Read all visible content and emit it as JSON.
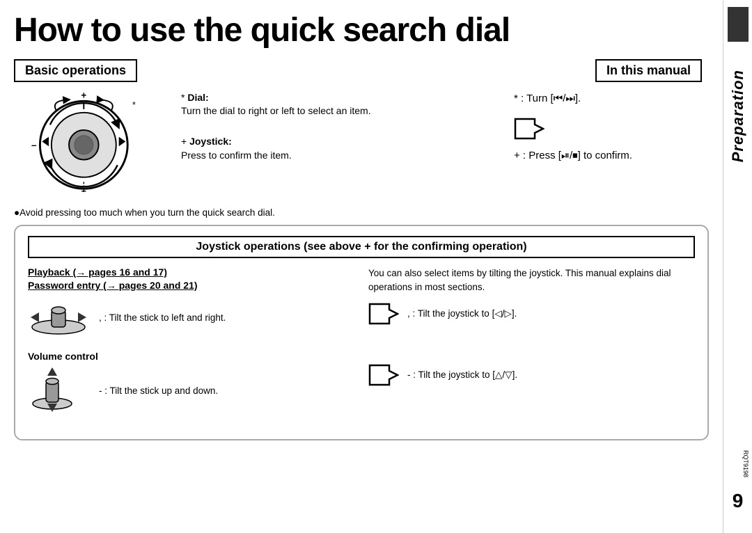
{
  "title": "How to use the quick search dial",
  "header": {
    "basic_ops": "Basic operations",
    "in_manual": "In this manual"
  },
  "dial_section": {
    "dial_label": "Dial:",
    "dial_desc": "Turn the dial to right or left to select an item.",
    "joystick_label": "Joystick:",
    "joystick_desc": "Press to confirm the item.",
    "star_note": "* : Turn [",
    "star_note2": "].",
    "plus_note": "+ : Press [",
    "plus_note2": "] to confirm.",
    "avoid_note": "●Avoid pressing too much when you turn the quick search dial."
  },
  "joystick_box": {
    "title": "Joystick operations (see above +  for the confirming operation)",
    "link1": "Playback (→ pages 16 and 17)",
    "link2": "Password entry (→ pages 20 and 21)",
    "desc_text": "You can also select items by tilting the joystick. This manual explains dial operations in most sections.",
    "lr_comma": ",",
    "lr_desc": ": Tilt the stick to left and right.",
    "lr_manual_comma": ",",
    "lr_manual_desc": ": Tilt the joystick to [◁/▷].",
    "volume_label": "Volume control",
    "ud_dash": "-",
    "ud_desc": ": Tilt the stick up and down.",
    "ud_manual_dash": "-",
    "ud_manual_desc": ": Tilt the joystick to [△/▽]."
  },
  "side": {
    "label": "Preparation",
    "number": "9",
    "rqt": "RQT9198"
  }
}
